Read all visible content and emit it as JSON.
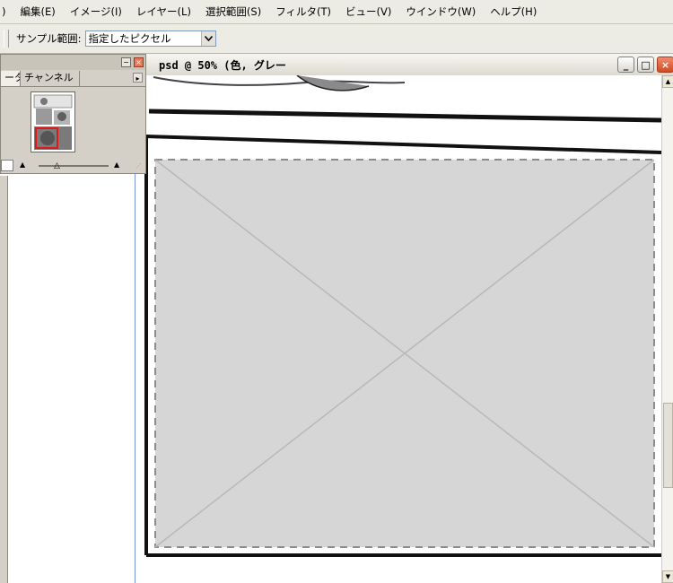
{
  "menu": {
    "items": [
      {
        "label": ")"
      },
      {
        "label": "編集(E)"
      },
      {
        "label": "イメージ(I)"
      },
      {
        "label": "レイヤー(L)"
      },
      {
        "label": "選択範囲(S)"
      },
      {
        "label": "フィルタ(T)"
      },
      {
        "label": "ビュー(V)"
      },
      {
        "label": "ウインドウ(W)"
      },
      {
        "label": "ヘルプ(H)"
      }
    ]
  },
  "options": {
    "sample_label": "サンプル範囲:",
    "sample_value": "指定したピクセル"
  },
  "document": {
    "title": "psd @ 50% (色, グレー",
    "minimize_glyph": "_",
    "maximize_glyph": "□",
    "close_glyph": "×"
  },
  "navigator": {
    "tabs": [
      {
        "label": "ータ"
      },
      {
        "label": "チャンネル"
      }
    ],
    "tab_menu_glyph": "▸",
    "minimize_glyph": "−",
    "close_glyph": "×",
    "zoom_out_glyph": "▲",
    "zoom_in_glyph": "▲",
    "slider_knob_glyph": "△"
  },
  "icons": {
    "dropdown": "chevron-down-icon",
    "scroll_up": "arrow-up-icon",
    "scroll_down": "arrow-down-icon"
  },
  "colors": {
    "menubar": "#ecece4",
    "viewbox": "#e01818",
    "close_button": "#d34a21"
  }
}
